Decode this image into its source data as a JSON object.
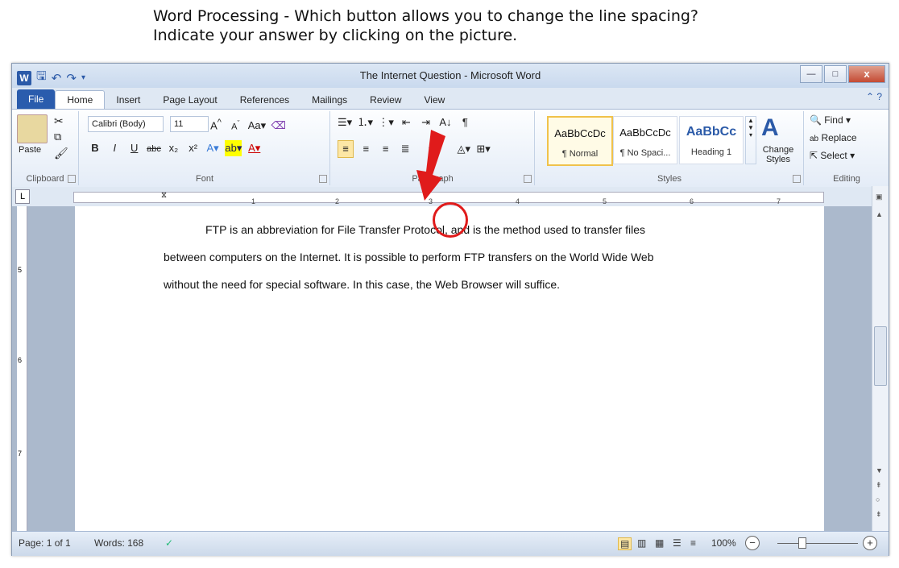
{
  "question": {
    "line1": "Word Processing - Which button allows you to change the line spacing?",
    "line2": "Indicate your answer by clicking on the picture."
  },
  "window": {
    "title": "The Internet Question - Microsoft Word",
    "close_label": "x",
    "min_label": "—",
    "max_label": "□"
  },
  "tabs": [
    "File",
    "Home",
    "Insert",
    "Page Layout",
    "References",
    "Mailings",
    "Review",
    "View"
  ],
  "ribbon": {
    "clipboard": {
      "label": "Clipboard",
      "paste": "Paste"
    },
    "font": {
      "label": "Font",
      "name": "Calibri (Body)",
      "size": "11"
    },
    "paragraph": {
      "label": "Paragraph"
    },
    "styles": {
      "label": "Styles",
      "items": [
        {
          "preview": "AaBbCcDc",
          "name": "¶ Normal"
        },
        {
          "preview": "AaBbCcDc",
          "name": "¶ No Spaci..."
        },
        {
          "preview": "AaBbCc",
          "name": "Heading 1"
        }
      ],
      "change_styles": "Change Styles"
    },
    "editing": {
      "label": "Editing",
      "find": "Find",
      "replace": "Replace",
      "select": "Select"
    }
  },
  "ruler_numbers": [
    "1",
    "2",
    "3",
    "4",
    "5",
    "6",
    "7"
  ],
  "vruler_numbers": [
    "5",
    "6",
    "7"
  ],
  "document": {
    "line1": "FTP is an abbreviation for File Transfer Protocol, and is the method used to transfer files",
    "line2": "between computers on the Internet.  It is possible to perform FTP transfers on the World Wide Web",
    "line3": "without the need for special software. In this case, the Web Browser will suffice."
  },
  "status": {
    "page": "Page: 1 of 1",
    "words": "Words: 168",
    "zoom": "100%"
  }
}
